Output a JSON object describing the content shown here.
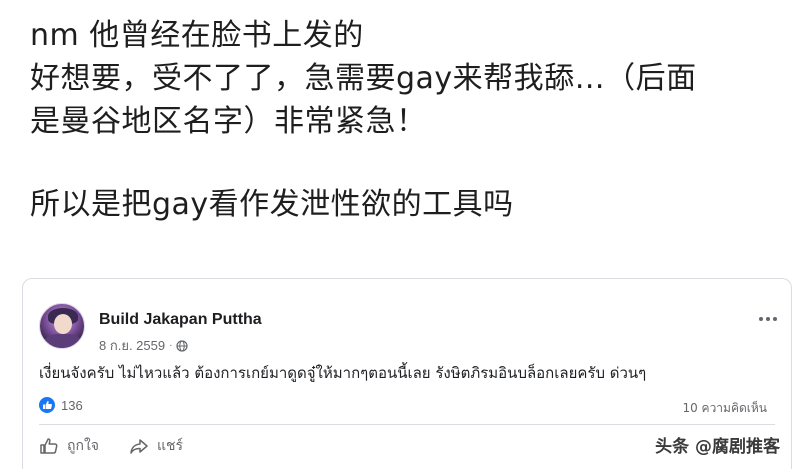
{
  "caption": {
    "lines": [
      "nm 他曾经在脸书上发的",
      "好想要，受不了了，急需要gay来帮我舔…（后面",
      "是曼谷地区名字）非常紧急！",
      "所以是把gay看作发泄性欲的工具吗"
    ]
  },
  "post": {
    "author": "Build Jakapan Puttha",
    "date": "8 ก.ย. 2559",
    "separator": "·",
    "text": "เงี่ยนจังครับ ไม่ไหวแล้ว ต้องการเกย์มาดูดจู๋ให้มากๆตอนนี้เลย รังษิตภิรมอินบล็อกเลยครับ ด่วนๆ",
    "reaction_count": "136",
    "comment_count": "10 ความคิดเห็น",
    "actions": {
      "like_label": "ถูกใจ",
      "share_label": "แชร์"
    },
    "icons": [
      "globe-icon",
      "more-icon",
      "like-icon",
      "thumbs-up-icon",
      "share-icon"
    ],
    "accent": "#1877f2"
  },
  "watermark": "头条 @腐剧推客"
}
